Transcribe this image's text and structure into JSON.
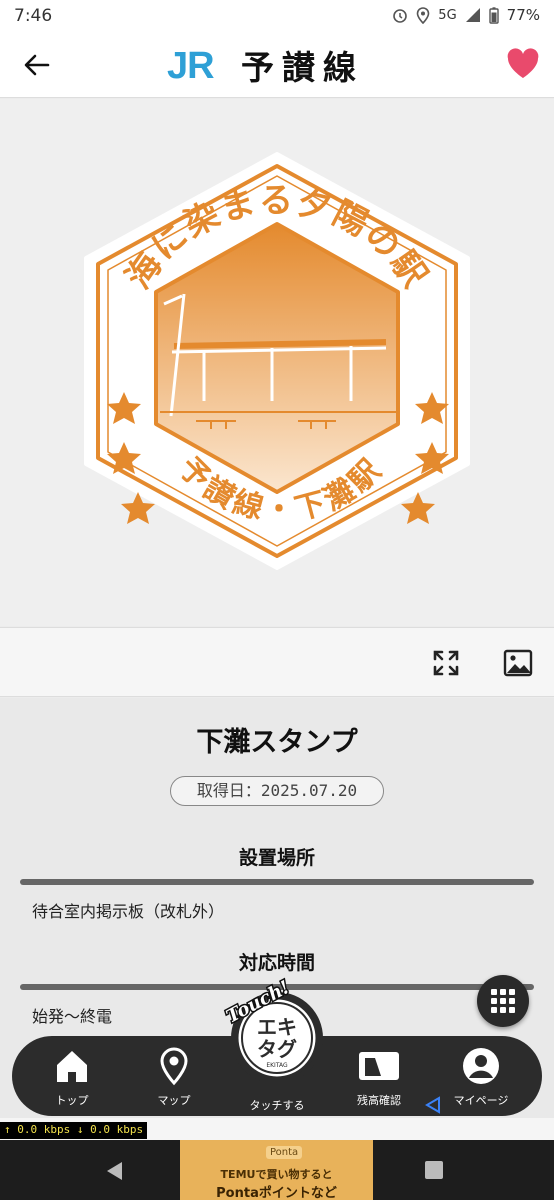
{
  "status_bar": {
    "time": "7:46",
    "network": "5G",
    "battery": "77%"
  },
  "header": {
    "logo": "JR",
    "title": "予讃線"
  },
  "stamp_image": {
    "top_text": "海に染まる夕陽の駅",
    "bottom_text": "予讃線・下灘駅",
    "primary_color": "#e48a2e"
  },
  "stamp": {
    "name": "下灘スタンプ",
    "acquired": "取得日：2025.07.20"
  },
  "sections": [
    {
      "title": "設置場所",
      "text": "待合室内掲示板（改札外）"
    },
    {
      "title": "対応時間",
      "text": "始発～終電"
    }
  ],
  "touch_button": {
    "badge": "Touch!",
    "logo_top": "エキ",
    "logo_bottom": "タグ",
    "sub": "EKITAG"
  },
  "nav": [
    {
      "label": "トップ",
      "icon": "home-icon"
    },
    {
      "label": "マップ",
      "icon": "map-pin-icon"
    },
    {
      "label": "タッチする",
      "icon": "touch-icon"
    },
    {
      "label": "残高確認",
      "icon": "card-icon"
    },
    {
      "label": "マイページ",
      "icon": "user-icon"
    }
  ],
  "speed_meter": "↑  0.0 kbps  ↓   0.0 kbps",
  "ad": {
    "tag": "Ponta",
    "line1": "TEMUで買い物すると",
    "line2": "Pontaポイントなど"
  },
  "colors": {
    "heart": "#e94a6c",
    "jr_blue": "#2ea0d6",
    "stamp_orange": "#e48a2e"
  }
}
